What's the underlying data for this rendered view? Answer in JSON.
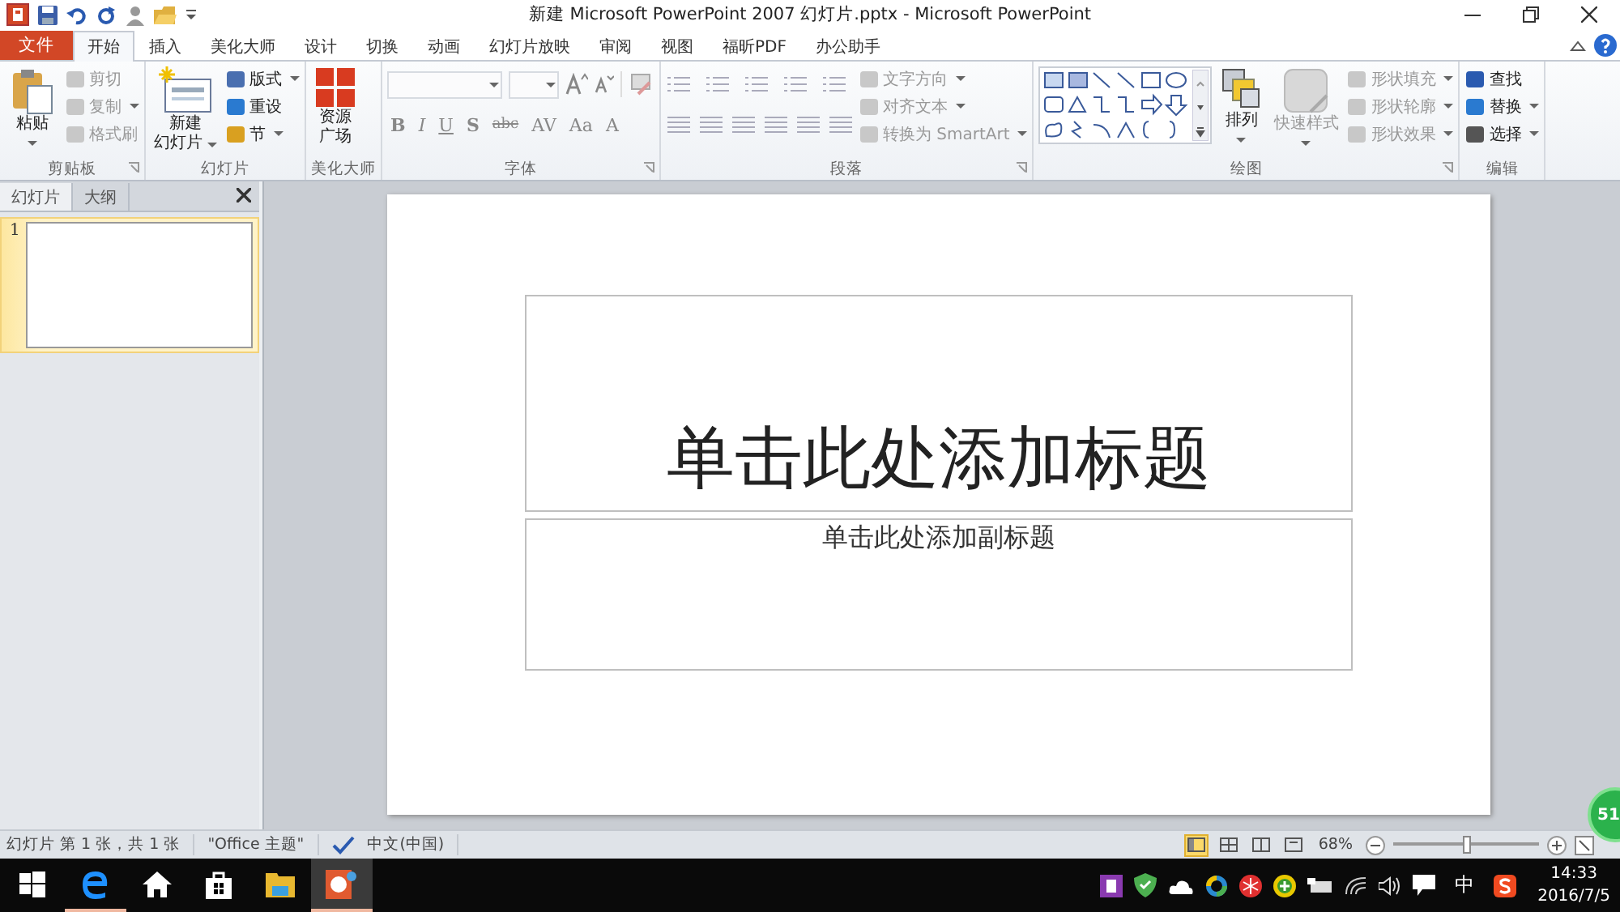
{
  "window": {
    "title": "新建 Microsoft PowerPoint 2007 幻灯片.pptx - Microsoft PowerPoint"
  },
  "tabs": [
    {
      "label": "文件",
      "kind": "file",
      "selected": false
    },
    {
      "label": "开始",
      "kind": "tab",
      "selected": true
    },
    {
      "label": "插入",
      "kind": "tab",
      "selected": false
    },
    {
      "label": "美化大师",
      "kind": "tab",
      "selected": false
    },
    {
      "label": "设计",
      "kind": "tab",
      "selected": false
    },
    {
      "label": "切换",
      "kind": "tab",
      "selected": false
    },
    {
      "label": "动画",
      "kind": "tab",
      "selected": false
    },
    {
      "label": "幻灯片放映",
      "kind": "tab",
      "selected": false
    },
    {
      "label": "审阅",
      "kind": "tab",
      "selected": false
    },
    {
      "label": "视图",
      "kind": "tab",
      "selected": false
    },
    {
      "label": "福昕PDF",
      "kind": "tab",
      "selected": false
    },
    {
      "label": "办公助手",
      "kind": "tab",
      "selected": false
    }
  ],
  "ribbon_groups": [
    {
      "label": "剪贴板",
      "launcher": true,
      "items": [
        {
          "kind": "large",
          "lines": [
            "粘贴"
          ],
          "dropdown": true,
          "disabled": false
        },
        {
          "kind": "stack",
          "rows": [
            {
              "label": "剪切",
              "disabled": true,
              "dropdown": false
            },
            {
              "label": "复制",
              "disabled": true,
              "dropdown": true
            },
            {
              "label": "格式刷",
              "disabled": true,
              "dropdown": false
            }
          ]
        }
      ]
    },
    {
      "label": "幻灯片",
      "launcher": false,
      "items": [
        {
          "kind": "large",
          "lines": [
            "新建",
            "幻灯片"
          ],
          "dropdown": true,
          "disabled": false
        },
        {
          "kind": "stack",
          "rows": [
            {
              "label": "版式",
              "disabled": false,
              "dropdown": true
            },
            {
              "label": "重设",
              "disabled": false,
              "dropdown": false
            },
            {
              "label": "节",
              "disabled": false,
              "dropdown": true
            }
          ]
        }
      ]
    },
    {
      "label": "美化大师",
      "launcher": false,
      "items": [
        {
          "kind": "large",
          "lines": [
            "资源",
            "广场"
          ],
          "dropdown": false,
          "disabled": false
        }
      ]
    },
    {
      "label": "字体",
      "launcher": true,
      "items": [
        {
          "kind": "font",
          "format_buttons": [
            "B",
            "I",
            "U",
            "S",
            "abc",
            "AV",
            "Aa",
            "A"
          ],
          "disabled": true
        }
      ]
    },
    {
      "label": "段落",
      "launcher": true,
      "items": [
        {
          "kind": "paragraph",
          "disabled": true
        },
        {
          "kind": "stack",
          "rows": [
            {
              "label": "文字方向",
              "disabled": true,
              "dropdown": true
            },
            {
              "label": "对齐文本",
              "disabled": true,
              "dropdown": true
            },
            {
              "label": "转换为 SmartArt",
              "disabled": true,
              "dropdown": true
            }
          ]
        }
      ]
    },
    {
      "label": "绘图",
      "launcher": true,
      "items": [
        {
          "kind": "gallery"
        },
        {
          "kind": "large",
          "lines": [
            "排列"
          ],
          "dropdown": true,
          "disabled": false
        },
        {
          "kind": "large",
          "lines": [
            "快速样式"
          ],
          "dropdown": true,
          "disabled": true
        },
        {
          "kind": "stack",
          "rows": [
            {
              "label": "形状填充",
              "disabled": true,
              "dropdown": true
            },
            {
              "label": "形状轮廓",
              "disabled": true,
              "dropdown": true
            },
            {
              "label": "形状效果",
              "disabled": true,
              "dropdown": true
            }
          ]
        }
      ]
    },
    {
      "label": "编辑",
      "launcher": false,
      "items": [
        {
          "kind": "stack",
          "rows": [
            {
              "label": "查找",
              "disabled": false,
              "dropdown": false
            },
            {
              "label": "替换",
              "disabled": false,
              "dropdown": true
            },
            {
              "label": "选择",
              "disabled": false,
              "dropdown": true
            }
          ]
        }
      ]
    }
  ],
  "side_panel": {
    "tabs": [
      {
        "label": "幻灯片",
        "selected": true
      },
      {
        "label": "大纲",
        "selected": false
      }
    ],
    "slides": [
      {
        "number": "1",
        "selected": true
      }
    ]
  },
  "slide": {
    "title_placeholder": "单击此处添加标题",
    "subtitle_placeholder": "单击此处添加副标题"
  },
  "status_bar": {
    "slide_info": "幻灯片 第 1 张，共 1 张",
    "theme": "\"Office 主题\"",
    "language": "中文(中国)",
    "views": [
      {
        "selected": true
      },
      {
        "selected": false
      },
      {
        "selected": false
      },
      {
        "selected": false
      }
    ],
    "zoom": "68%",
    "zoom_slider": {
      "level": 0.5
    }
  },
  "taskbar": {
    "apps": [
      {
        "running": false,
        "selected": false
      },
      {
        "running": true,
        "selected": false
      },
      {
        "running": false,
        "selected": false
      },
      {
        "running": false,
        "selected": false
      },
      {
        "running": false,
        "selected": false
      },
      {
        "running": true,
        "selected": true
      }
    ],
    "ime": "中",
    "time": "14:33",
    "date": "2016/7/5"
  },
  "floating_ball": {
    "text": "51"
  }
}
